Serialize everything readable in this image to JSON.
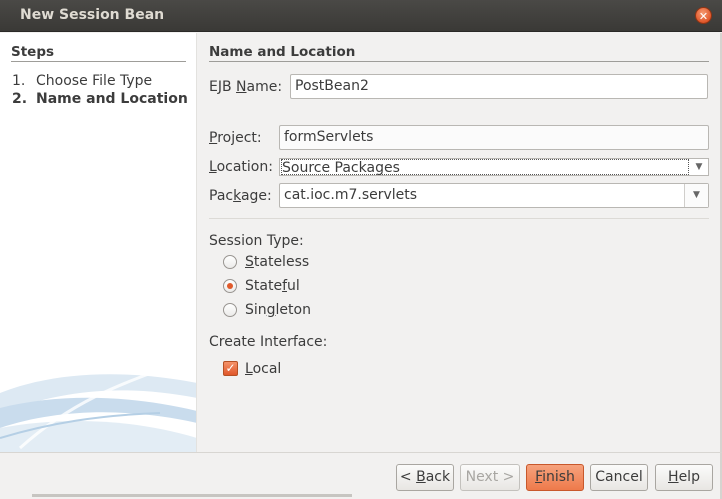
{
  "window": {
    "title": "New Session Bean",
    "close_icon": "close-icon"
  },
  "steps": {
    "heading": "Steps",
    "items": [
      {
        "num": "1.",
        "label": "Choose File Type",
        "active": false
      },
      {
        "num": "2.",
        "label": "Name and Location",
        "active": true
      }
    ]
  },
  "main": {
    "heading": "Name and Location",
    "ejb_name": {
      "label_pre": "EJB ",
      "label_mn": "N",
      "label_post": "ame:",
      "value": "PostBean2"
    },
    "project": {
      "label_mn": "P",
      "label_post": "roject:",
      "value": "formServlets"
    },
    "location": {
      "label_mn": "L",
      "label_post": "ocation:",
      "value": "Source Packages"
    },
    "package": {
      "label_pre": "Pac",
      "label_mn": "k",
      "label_post": "age:",
      "value": "cat.ioc.m7.servlets"
    },
    "session_type": {
      "label": "Session Type:",
      "options": [
        {
          "pre": "",
          "mn": "S",
          "post": "tateless",
          "selected": false
        },
        {
          "pre": "State",
          "mn": "f",
          "post": "ul",
          "selected": true
        },
        {
          "pre": "Sin",
          "mn": "g",
          "post": "leton",
          "selected": false
        }
      ]
    },
    "create_interface": {
      "label": "Create Interface:",
      "local": {
        "pre": "",
        "mn": "L",
        "post": "ocal",
        "checked": true
      }
    }
  },
  "buttons": {
    "back": {
      "pre": "< ",
      "mn": "B",
      "post": "ack"
    },
    "next": {
      "label": "Next >"
    },
    "finish": {
      "pre": "",
      "mn": "F",
      "post": "inish"
    },
    "cancel": {
      "label": "Cancel"
    },
    "help": {
      "pre": "",
      "mn": "H",
      "post": "elp"
    }
  },
  "colors": {
    "accent": "#e0572a",
    "titlebar": "#3c3b37",
    "panel": "#f2f1f0"
  }
}
